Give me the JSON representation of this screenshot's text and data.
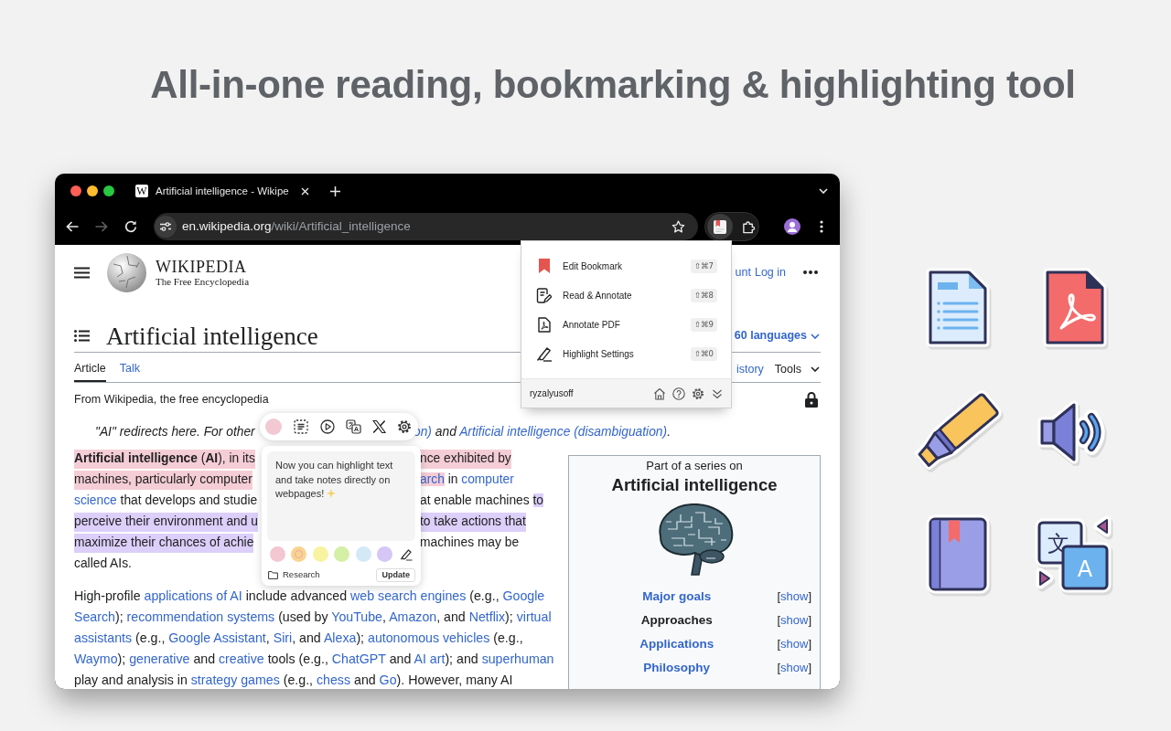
{
  "headline": "All-in-one reading, bookmarking & highlighting tool",
  "browser": {
    "tabs": [
      {
        "favicon": "W",
        "title": "Artificial intelligence - Wikipe"
      }
    ],
    "nav_buttons": [
      {
        "kind": "back",
        "disabled": false
      },
      {
        "kind": "forward",
        "disabled": true
      },
      {
        "kind": "reload",
        "disabled": false
      }
    ],
    "address": {
      "host": "en.wikipedia.org",
      "path": "/wiki/Artificial_intelligence"
    },
    "extension_button": {
      "active": true
    }
  },
  "wiki": {
    "wordmark": "WIKIPEDIA",
    "tagline": "The Free Encyclopedia",
    "account_links": [
      "unt",
      "Log in"
    ],
    "title": "Artificial intelligence",
    "languages": "60 languages",
    "tabs": [
      {
        "label": "Article",
        "selected": true
      },
      {
        "label": "Talk",
        "selected": false
      }
    ],
    "view_tabs": [
      {
        "label": "istory",
        "kind": "link"
      },
      {
        "label": "Tools",
        "kind": "menu"
      }
    ],
    "from": "From Wikipedia, the free encyclopedia",
    "hatnote": {
      "left": [
        {
          "text": "\"AI\" redirects here. For other",
          "link": false
        }
      ],
      "right": [
        {
          "text": "on)",
          "link": true
        },
        {
          "text": " and ",
          "link": false
        },
        {
          "text": "Artificial intelligence (disambiguation)",
          "link": true
        },
        {
          "text": ".",
          "link": false
        }
      ]
    },
    "lead_lines": [
      {
        "left": [
          {
            "text": "**Artificial intelligence** (**AI**), in its",
            "link": false,
            "color": "#f5cdd6"
          }
        ],
        "right": [
          {
            "text": "nce exhibited by",
            "link": false,
            "color": "#f5cdd6"
          }
        ]
      },
      {
        "left": [
          {
            "text": "machines, particularly computer",
            "link": false,
            "color": "#f5cdd6"
          }
        ],
        "right": [
          {
            "text": "arch",
            "link": true,
            "color": "#f5cdd6"
          },
          {
            "text": " in ",
            "link": false
          },
          {
            "text": "computer",
            "link": true
          }
        ]
      },
      {
        "left": [
          {
            "text": "science",
            "link": true
          },
          {
            "text": " that develops and studie",
            "link": false
          }
        ],
        "right": [
          {
            "text": "at enable machines ",
            "link": false
          },
          {
            "text": "to",
            "link": false,
            "color": "#dccffa"
          }
        ]
      },
      {
        "left": [
          {
            "text": "perceive their environment and u",
            "link": false,
            "color": "#dccffa"
          }
        ],
        "right": [
          {
            "text": "to take actions that",
            "link": false,
            "color": "#dccffa"
          }
        ]
      },
      {
        "left": [
          {
            "text": "maximize their chances of achie",
            "link": false,
            "color": "#dccffa"
          }
        ],
        "right": [
          {
            "text": "machines may be",
            "link": false
          }
        ]
      },
      {
        "left": [
          {
            "text": "called AIs.",
            "link": false
          }
        ]
      }
    ],
    "paragraph_lines": [
      [
        {
          "text": "High-profile ",
          "link": false
        },
        {
          "text": "applications of AI",
          "link": true
        },
        {
          "text": " include advanced ",
          "link": false
        },
        {
          "text": "web search engines",
          "link": true
        },
        {
          "text": " (e.g., ",
          "link": false
        },
        {
          "text": "Google",
          "link": true
        }
      ],
      [
        {
          "text": "Search",
          "link": true
        },
        {
          "text": "); ",
          "link": false
        },
        {
          "text": "recommendation systems",
          "link": true
        },
        {
          "text": " (used by ",
          "link": false
        },
        {
          "text": "YouTube",
          "link": true
        },
        {
          "text": ", ",
          "link": false
        },
        {
          "text": "Amazon",
          "link": true
        },
        {
          "text": ", and ",
          "link": false
        },
        {
          "text": "Netflix",
          "link": true
        },
        {
          "text": "); ",
          "link": false
        },
        {
          "text": "virtual",
          "link": true
        }
      ],
      [
        {
          "text": "assistants",
          "link": true
        },
        {
          "text": " (e.g., ",
          "link": false
        },
        {
          "text": "Google Assistant",
          "link": true
        },
        {
          "text": ", ",
          "link": false
        },
        {
          "text": "Siri",
          "link": true
        },
        {
          "text": ", and ",
          "link": false
        },
        {
          "text": "Alexa",
          "link": true
        },
        {
          "text": "); ",
          "link": false
        },
        {
          "text": "autonomous vehicles",
          "link": true
        },
        {
          "text": " (e.g.,",
          "link": false
        }
      ],
      [
        {
          "text": "Waymo",
          "link": true
        },
        {
          "text": "); ",
          "link": false
        },
        {
          "text": "generative",
          "link": true
        },
        {
          "text": " and ",
          "link": false
        },
        {
          "text": "creative",
          "link": true
        },
        {
          "text": " tools (e.g., ",
          "link": false
        },
        {
          "text": "ChatGPT",
          "link": true
        },
        {
          "text": " and ",
          "link": false
        },
        {
          "text": "AI art",
          "link": true
        },
        {
          "text": "); and ",
          "link": false
        },
        {
          "text": "superhuman",
          "link": true
        }
      ],
      [
        {
          "text": "play and analysis in ",
          "link": false
        },
        {
          "text": "strategy games",
          "link": true
        },
        {
          "text": " (e.g., ",
          "link": false
        },
        {
          "text": "chess",
          "link": true
        },
        {
          "text": " and ",
          "link": false
        },
        {
          "text": "Go",
          "link": true
        },
        {
          "text": "). However, many AI",
          "link": false
        }
      ]
    ],
    "infobox": {
      "above": "Part of a series on",
      "title": "Artificial intelligence",
      "rows": [
        {
          "label": "Major goals",
          "link": true,
          "toggle": {
            "open": "[",
            "label": "show",
            "close": "]"
          }
        },
        {
          "label": "Approaches",
          "link": false,
          "toggle": {
            "open": "[",
            "label": "show",
            "close": "]"
          }
        },
        {
          "label": "Applications",
          "link": true,
          "toggle": {
            "open": "[",
            "label": "show",
            "close": "]"
          }
        },
        {
          "label": "Philosophy",
          "link": true,
          "toggle": {
            "open": "[",
            "label": "show",
            "close": "]"
          }
        }
      ]
    }
  },
  "extension_menu": {
    "items": [
      {
        "kind": "bookmark",
        "label": "Edit Bookmark",
        "shortcut": "⇧⌘7"
      },
      {
        "kind": "annotate",
        "label": "Read & Annotate",
        "shortcut": "⇧⌘8"
      },
      {
        "kind": "pdf",
        "label": "Annotate PDF",
        "shortcut": "⇧⌘9"
      },
      {
        "kind": "highlight",
        "label": "Highlight Settings",
        "shortcut": "⇧⌘0"
      }
    ],
    "username": "ryzalyusoff"
  },
  "highlight_toolbar": {
    "color": "#f2c9d3"
  },
  "note": {
    "text": "Now you can highlight text and take notes directly on webpages!",
    "swatches": [
      {
        "color": "#f3c7d1",
        "selected": false
      },
      {
        "color": "#f9d48f",
        "selected": true
      },
      {
        "color": "#f8f3a0",
        "selected": false
      },
      {
        "color": "#d4efa6",
        "selected": false
      },
      {
        "color": "#d3e9f6",
        "selected": false
      },
      {
        "color": "#d5c6f5",
        "selected": false
      }
    ],
    "folder": "Research",
    "button": "Update"
  },
  "feature_icons": [
    {
      "kind": "document"
    },
    {
      "kind": "pdf"
    },
    {
      "kind": "highlighter"
    },
    {
      "kind": "speaker"
    },
    {
      "kind": "book"
    },
    {
      "kind": "translate",
      "glyphs": [
        "文",
        "A"
      ]
    }
  ]
}
